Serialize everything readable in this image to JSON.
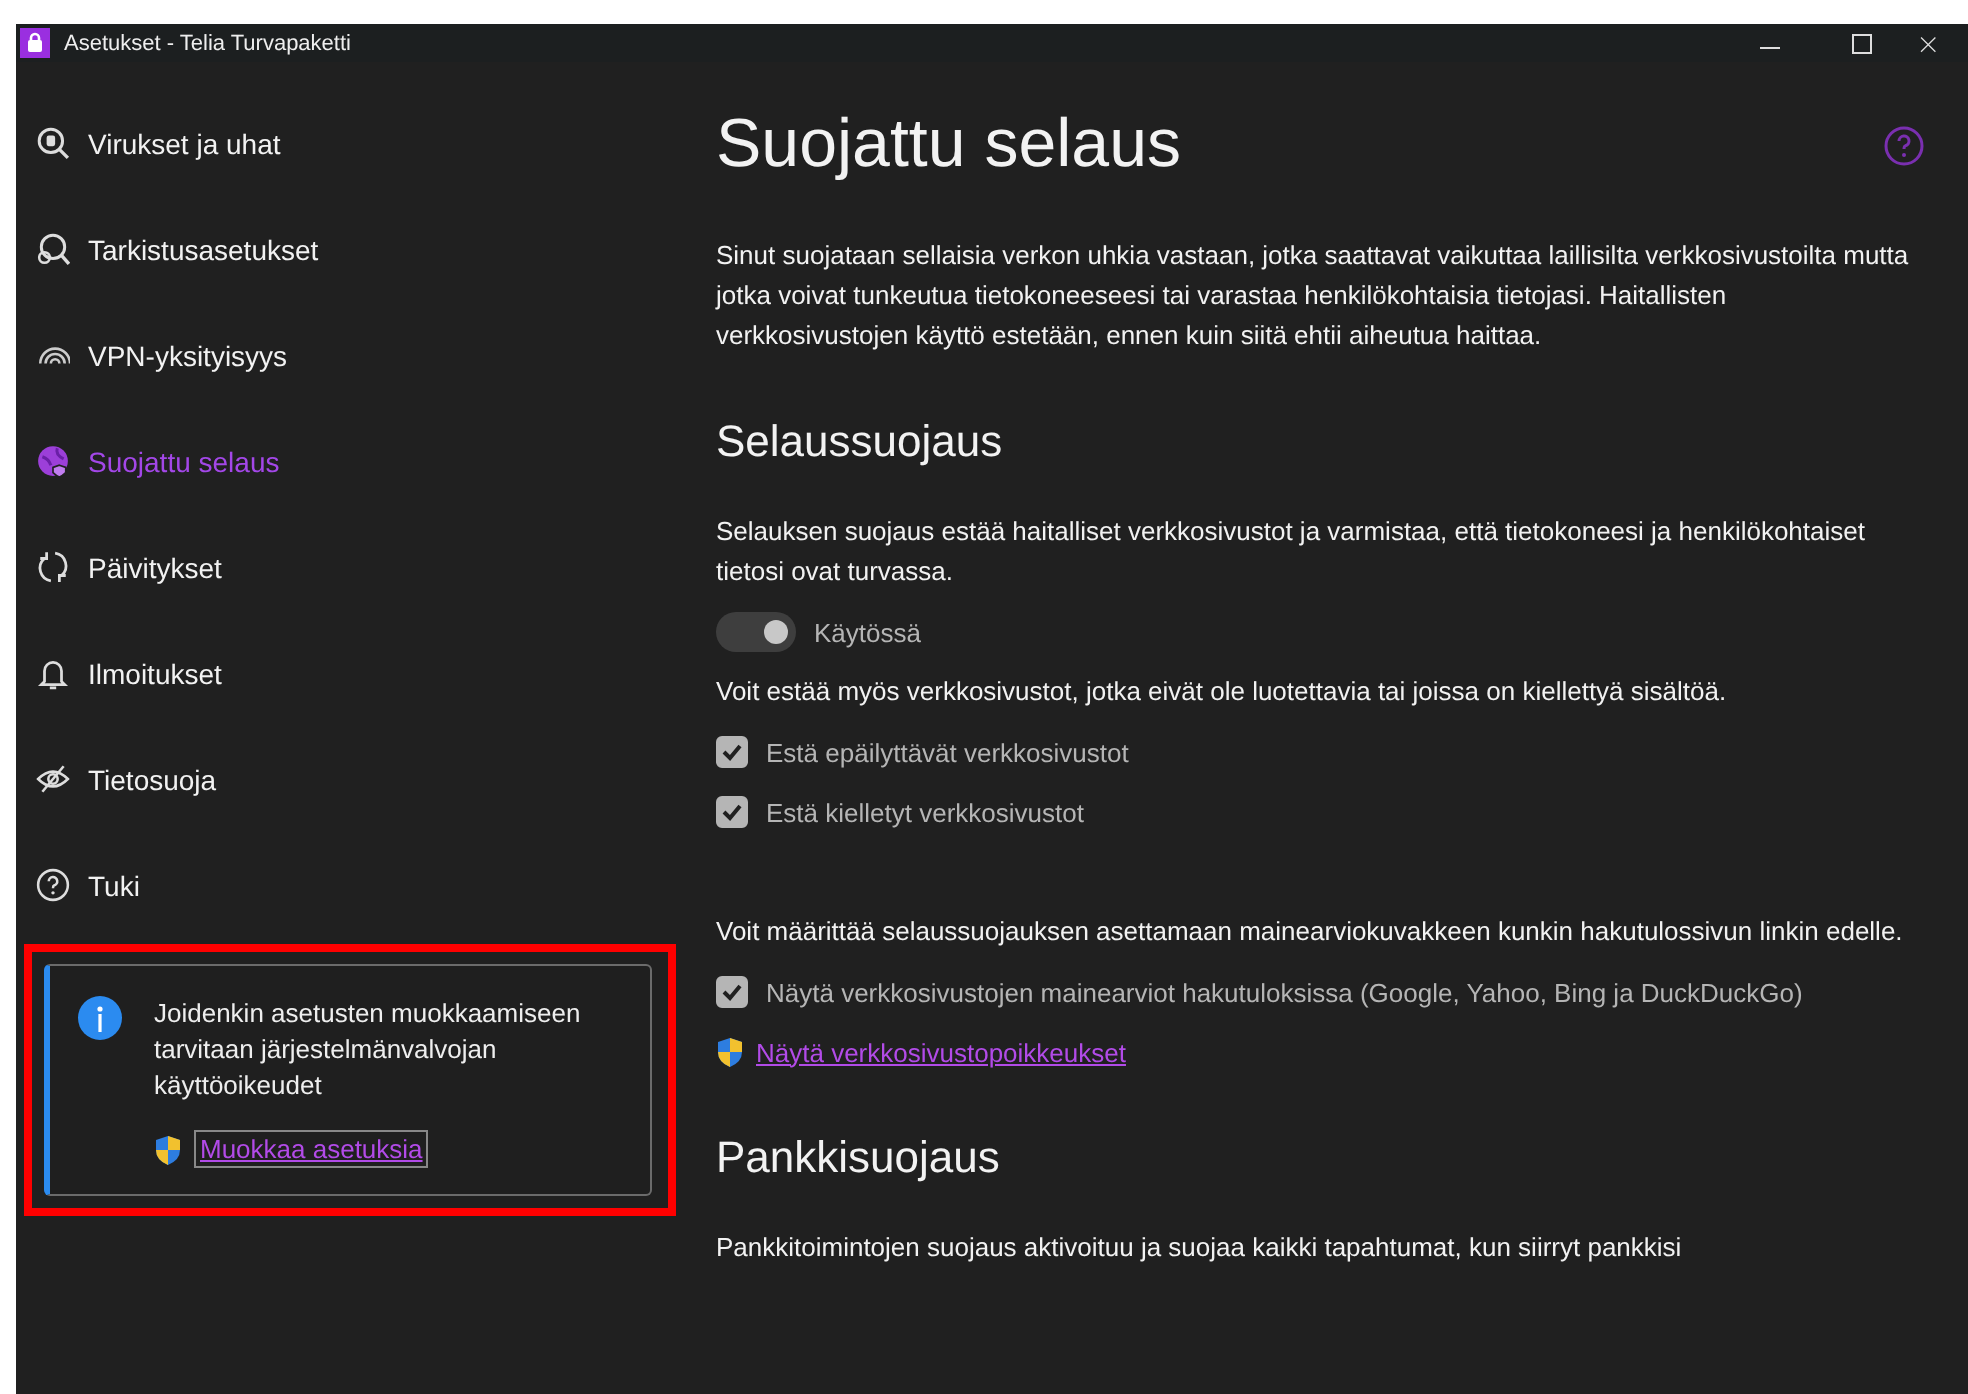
{
  "window": {
    "title": "Asetukset - Telia Turvapaketti"
  },
  "sidebar": {
    "items": [
      {
        "label": "Virukset ja uhat",
        "selected": false
      },
      {
        "label": "Tarkistusasetukset",
        "selected": false
      },
      {
        "label": "VPN-yksityisyys",
        "selected": false
      },
      {
        "label": "Suojattu selaus",
        "selected": true
      },
      {
        "label": "Päivitykset",
        "selected": false
      },
      {
        "label": "Ilmoitukset",
        "selected": false
      },
      {
        "label": "Tietosuoja",
        "selected": false
      },
      {
        "label": "Tuki",
        "selected": false
      }
    ]
  },
  "notice": {
    "text": "Joidenkin asetusten muokkaamiseen tarvitaan järjestelmänvalvojan käyttöoikeudet",
    "link": "Muokkaa asetuksia",
    "highlighted": true
  },
  "content": {
    "title": "Suojattu selaus",
    "intro": "Sinut suojataan sellaisia verkon uhkia vastaan, jotka saattavat vaikuttaa laillisilta verkkosivustoilta mutta jotka voivat tunkeutua tietokoneeseesi tai varastaa henkilökohtaisia tietojasi. Haitallisten verkkosivustojen käyttö estetään, ennen kuin siitä ehtii aiheutua haittaa.",
    "sections": [
      {
        "heading": "Selaussuojaus",
        "blocks": [
          {
            "kind": "text",
            "text": "Selauksen suojaus estää haitalliset verkkosivustot ja varmistaa, että tietokoneesi ja henkilökohtaiset tietosi ovat turvassa."
          },
          {
            "kind": "toggle",
            "label": "Käytössä",
            "on": true,
            "disabled": true
          },
          {
            "kind": "text",
            "text": "Voit estää myös verkkosivustot, jotka eivät ole luotettavia tai joissa on kiellettyä sisältöä."
          },
          {
            "kind": "checkbox",
            "label": "Estä epäilyttävät verkkosivustot",
            "checked": true,
            "disabled": true
          },
          {
            "kind": "checkbox",
            "label": "Estä kielletyt verkkosivustot",
            "checked": true,
            "disabled": true
          },
          {
            "kind": "spacer"
          },
          {
            "kind": "text",
            "text": "Voit määrittää selaussuojauksen asettamaan mainearviokuvakkeen kunkin hakutulossivun linkin edelle."
          },
          {
            "kind": "checkbox",
            "label": "Näytä verkkosivustojen mainearviot hakutuloksissa (Google, Yahoo, Bing ja DuckDuckGo)",
            "checked": true,
            "disabled": true
          },
          {
            "kind": "link",
            "label": "Näytä verkkosivustopoikkeukset"
          }
        ]
      },
      {
        "heading": "Pankkisuojaus",
        "blocks": [
          {
            "kind": "text",
            "text": "Pankkitoimintojen suojaus aktivoituu ja suojaa kaikki tapahtumat, kun siirryt pankkisi"
          }
        ]
      }
    ]
  }
}
